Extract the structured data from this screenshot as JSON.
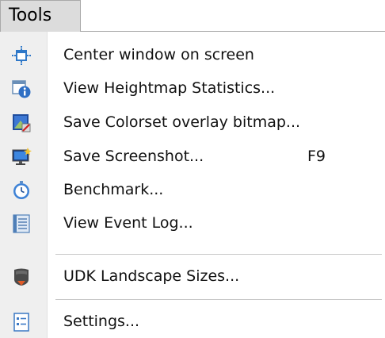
{
  "menu": {
    "title": "Tools",
    "items": [
      {
        "label": "Center window on screen",
        "icon": "center-window-icon"
      },
      {
        "label": "View Heightmap Statistics...",
        "icon": "info-window-icon"
      },
      {
        "label": "Save Colorset overlay bitmap...",
        "icon": "colorset-bitmap-icon"
      },
      {
        "label": "Save Screenshot...",
        "shortcut": "F9",
        "icon": "monitor-screenshot-icon"
      },
      {
        "label": "Benchmark...",
        "icon": "stopwatch-icon"
      },
      {
        "label": "View Event Log...",
        "icon": "event-log-icon"
      },
      {
        "label": "UDK Landscape Sizes...",
        "icon": "udk-landscape-icon"
      },
      {
        "label": "Settings...",
        "icon": "settings-document-icon"
      }
    ]
  },
  "colors": {
    "gutter": "#efefef",
    "tab_background": "#dcdcdc",
    "accent_blue": "#3a7fd0"
  }
}
